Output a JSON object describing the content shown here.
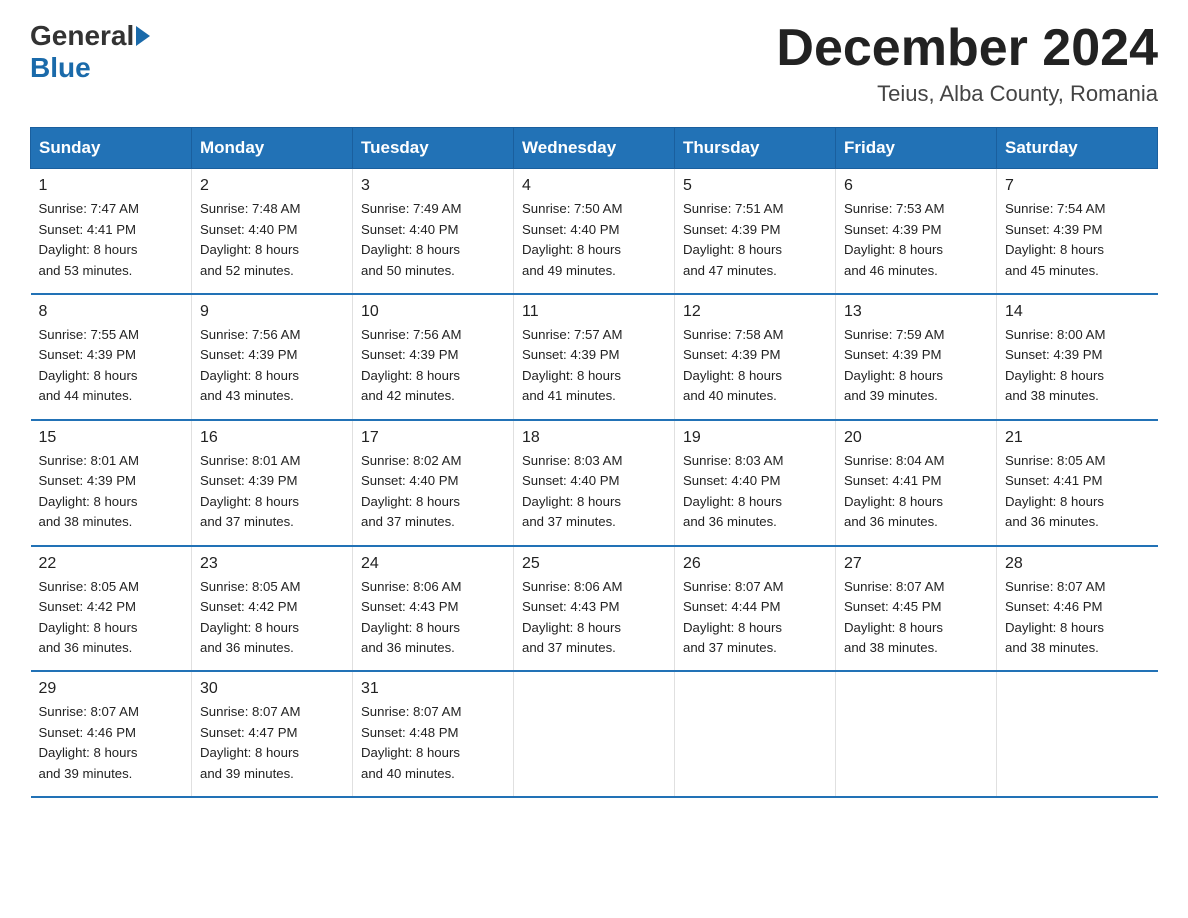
{
  "header": {
    "logo": {
      "general": "General",
      "blue": "Blue"
    },
    "title": "December 2024",
    "location": "Teius, Alba County, Romania"
  },
  "weekdays": [
    "Sunday",
    "Monday",
    "Tuesday",
    "Wednesday",
    "Thursday",
    "Friday",
    "Saturday"
  ],
  "weeks": [
    [
      {
        "day": "1",
        "sunrise": "7:47 AM",
        "sunset": "4:41 PM",
        "daylight": "8 hours and 53 minutes."
      },
      {
        "day": "2",
        "sunrise": "7:48 AM",
        "sunset": "4:40 PM",
        "daylight": "8 hours and 52 minutes."
      },
      {
        "day": "3",
        "sunrise": "7:49 AM",
        "sunset": "4:40 PM",
        "daylight": "8 hours and 50 minutes."
      },
      {
        "day": "4",
        "sunrise": "7:50 AM",
        "sunset": "4:40 PM",
        "daylight": "8 hours and 49 minutes."
      },
      {
        "day": "5",
        "sunrise": "7:51 AM",
        "sunset": "4:39 PM",
        "daylight": "8 hours and 47 minutes."
      },
      {
        "day": "6",
        "sunrise": "7:53 AM",
        "sunset": "4:39 PM",
        "daylight": "8 hours and 46 minutes."
      },
      {
        "day": "7",
        "sunrise": "7:54 AM",
        "sunset": "4:39 PM",
        "daylight": "8 hours and 45 minutes."
      }
    ],
    [
      {
        "day": "8",
        "sunrise": "7:55 AM",
        "sunset": "4:39 PM",
        "daylight": "8 hours and 44 minutes."
      },
      {
        "day": "9",
        "sunrise": "7:56 AM",
        "sunset": "4:39 PM",
        "daylight": "8 hours and 43 minutes."
      },
      {
        "day": "10",
        "sunrise": "7:56 AM",
        "sunset": "4:39 PM",
        "daylight": "8 hours and 42 minutes."
      },
      {
        "day": "11",
        "sunrise": "7:57 AM",
        "sunset": "4:39 PM",
        "daylight": "8 hours and 41 minutes."
      },
      {
        "day": "12",
        "sunrise": "7:58 AM",
        "sunset": "4:39 PM",
        "daylight": "8 hours and 40 minutes."
      },
      {
        "day": "13",
        "sunrise": "7:59 AM",
        "sunset": "4:39 PM",
        "daylight": "8 hours and 39 minutes."
      },
      {
        "day": "14",
        "sunrise": "8:00 AM",
        "sunset": "4:39 PM",
        "daylight": "8 hours and 38 minutes."
      }
    ],
    [
      {
        "day": "15",
        "sunrise": "8:01 AM",
        "sunset": "4:39 PM",
        "daylight": "8 hours and 38 minutes."
      },
      {
        "day": "16",
        "sunrise": "8:01 AM",
        "sunset": "4:39 PM",
        "daylight": "8 hours and 37 minutes."
      },
      {
        "day": "17",
        "sunrise": "8:02 AM",
        "sunset": "4:40 PM",
        "daylight": "8 hours and 37 minutes."
      },
      {
        "day": "18",
        "sunrise": "8:03 AM",
        "sunset": "4:40 PM",
        "daylight": "8 hours and 37 minutes."
      },
      {
        "day": "19",
        "sunrise": "8:03 AM",
        "sunset": "4:40 PM",
        "daylight": "8 hours and 36 minutes."
      },
      {
        "day": "20",
        "sunrise": "8:04 AM",
        "sunset": "4:41 PM",
        "daylight": "8 hours and 36 minutes."
      },
      {
        "day": "21",
        "sunrise": "8:05 AM",
        "sunset": "4:41 PM",
        "daylight": "8 hours and 36 minutes."
      }
    ],
    [
      {
        "day": "22",
        "sunrise": "8:05 AM",
        "sunset": "4:42 PM",
        "daylight": "8 hours and 36 minutes."
      },
      {
        "day": "23",
        "sunrise": "8:05 AM",
        "sunset": "4:42 PM",
        "daylight": "8 hours and 36 minutes."
      },
      {
        "day": "24",
        "sunrise": "8:06 AM",
        "sunset": "4:43 PM",
        "daylight": "8 hours and 36 minutes."
      },
      {
        "day": "25",
        "sunrise": "8:06 AM",
        "sunset": "4:43 PM",
        "daylight": "8 hours and 37 minutes."
      },
      {
        "day": "26",
        "sunrise": "8:07 AM",
        "sunset": "4:44 PM",
        "daylight": "8 hours and 37 minutes."
      },
      {
        "day": "27",
        "sunrise": "8:07 AM",
        "sunset": "4:45 PM",
        "daylight": "8 hours and 38 minutes."
      },
      {
        "day": "28",
        "sunrise": "8:07 AM",
        "sunset": "4:46 PM",
        "daylight": "8 hours and 38 minutes."
      }
    ],
    [
      {
        "day": "29",
        "sunrise": "8:07 AM",
        "sunset": "4:46 PM",
        "daylight": "8 hours and 39 minutes."
      },
      {
        "day": "30",
        "sunrise": "8:07 AM",
        "sunset": "4:47 PM",
        "daylight": "8 hours and 39 minutes."
      },
      {
        "day": "31",
        "sunrise": "8:07 AM",
        "sunset": "4:48 PM",
        "daylight": "8 hours and 40 minutes."
      },
      null,
      null,
      null,
      null
    ]
  ],
  "labels": {
    "sunrise": "Sunrise:",
    "sunset": "Sunset:",
    "daylight": "Daylight:"
  }
}
